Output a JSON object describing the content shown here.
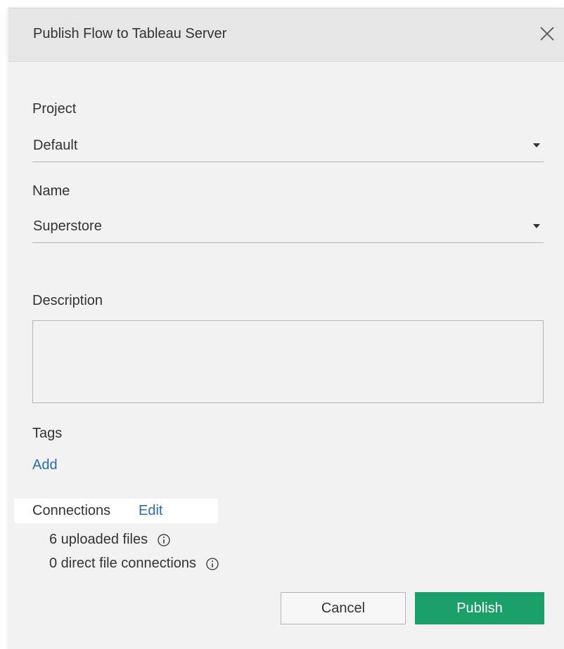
{
  "dialog": {
    "title": "Publish Flow to Tableau Server",
    "close_icon": "close-icon"
  },
  "project": {
    "label": "Project",
    "value": "Default"
  },
  "name": {
    "label": "Name",
    "value": "Superstore"
  },
  "description": {
    "label": "Description",
    "value": ""
  },
  "tags": {
    "label": "Tags",
    "add_link": "Add"
  },
  "connections": {
    "label": "Connections",
    "edit_link": "Edit",
    "uploaded_files": "6 uploaded files",
    "direct_connections": "0 direct file connections",
    "info_icon": "info-icon"
  },
  "buttons": {
    "cancel": "Cancel",
    "publish": "Publish"
  },
  "colors": {
    "publish_button": "#1aa068",
    "link": "#2a6bb0",
    "dialog_background": "#f2f2f2",
    "titlebar_background": "#e6e6e6"
  }
}
